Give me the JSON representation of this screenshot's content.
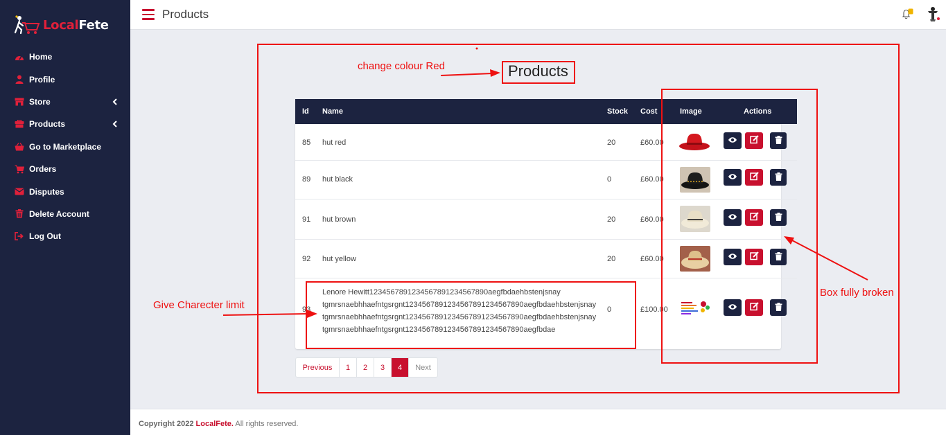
{
  "brand": {
    "part1": "Local",
    "part2": "Fete"
  },
  "sidebar": {
    "items": [
      {
        "label": "Home",
        "icon": "dashboard-icon"
      },
      {
        "label": "Profile",
        "icon": "user-icon"
      },
      {
        "label": "Store",
        "icon": "store-icon",
        "has_submenu": true
      },
      {
        "label": "Products",
        "icon": "products-icon",
        "has_submenu": true
      },
      {
        "label": "Go to Marketplace",
        "icon": "basket-icon"
      },
      {
        "label": "Orders",
        "icon": "cart-icon"
      },
      {
        "label": "Disputes",
        "icon": "envelope-icon"
      },
      {
        "label": "Delete Account",
        "icon": "trash-icon"
      },
      {
        "label": "Log Out",
        "icon": "logout-icon"
      }
    ]
  },
  "header": {
    "title": "Products"
  },
  "main": {
    "heading": "Products",
    "table": {
      "columns": [
        "Id",
        "Name",
        "Stock",
        "Cost",
        "Image",
        "Actions"
      ],
      "rows": [
        {
          "id": "85",
          "name": "hut red",
          "stock": "20",
          "cost": "£60.00",
          "image": "red-hat-image"
        },
        {
          "id": "89",
          "name": "hut black",
          "stock": "0",
          "cost": "£60.00",
          "image": "black-hat-image"
        },
        {
          "id": "91",
          "name": "hut brown",
          "stock": "20",
          "cost": "£60.00",
          "image": "straw-hat-image"
        },
        {
          "id": "92",
          "name": "hut yellow",
          "stock": "20",
          "cost": "£60.00",
          "image": "yellow-hat-image"
        },
        {
          "id": "93",
          "name_lines": [
            "Lenore Hewitt1234567891234567891234567890aegfbdaehbstenjsnay",
            "tgmrsnaebhhaefntgsrgnt1234567891234567891234567890aegfbdaehbstenjsnay",
            "tgmrsnaebhhaefntgsrgnt1234567891234567891234567890aegfbdaehbstenjsnay",
            "tgmrsnaebhhaefntgsrgnt1234567891234567891234567890aegfbdae"
          ],
          "stock": "0",
          "cost": "£100.00",
          "image": "chart-thumbnail-image"
        }
      ],
      "action_icons": [
        "eye-icon",
        "edit-icon",
        "trash-icon"
      ]
    },
    "pagination": {
      "previous": "Previous",
      "pages": [
        "1",
        "2",
        "3",
        "4"
      ],
      "active": "4",
      "next": "Next"
    }
  },
  "annotations": {
    "heading_note": "change colour Red",
    "name_note": "Give Charecter limit",
    "box_note": "Box fully broken"
  },
  "footer": {
    "prefix": "Copyright 2022",
    "brand": "LocalFete.",
    "suffix": "All rights reserved."
  },
  "colors": {
    "sidebar": "#1c2340",
    "accent": "#c8102e",
    "annotation": "#ee1111"
  }
}
